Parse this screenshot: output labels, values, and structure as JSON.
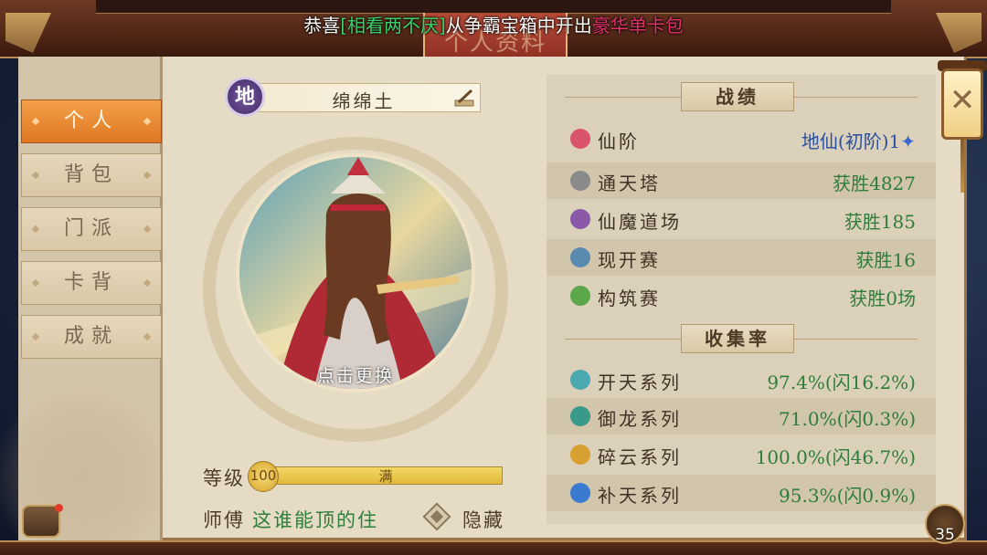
{
  "announcement": {
    "prefix": "恭喜",
    "player": "[相看两不厌]",
    "middle": "从争霸宝箱中开出",
    "item": "豪华单卡包"
  },
  "window_title": "个人资料",
  "sidebar": {
    "items": [
      {
        "label": "个人",
        "active": true
      },
      {
        "label": "背包",
        "active": false
      },
      {
        "label": "门派",
        "active": false
      },
      {
        "label": "卡背",
        "active": false
      },
      {
        "label": "成就",
        "active": false
      }
    ]
  },
  "profile": {
    "element_badge": "地",
    "name": "绵绵土",
    "change_label": "点击更换",
    "level_label": "等级",
    "level": "100",
    "level_fraction": 1.0,
    "level_full_label": "满",
    "master_label": "师傅",
    "master_name": "这谁能顶的住",
    "hide_label": "隐藏"
  },
  "record": {
    "title": "战绩",
    "rows": [
      {
        "label": "仙阶",
        "value": "地仙(初阶)1",
        "icon": "star-icon",
        "icon_color": "#d9546a"
      },
      {
        "label": "通天塔",
        "value": "获胜4827",
        "icon": "tower-icon",
        "icon_color": "#8a8a8a"
      },
      {
        "label": "仙魔道场",
        "value": "获胜185",
        "icon": "swords-icon",
        "icon_color": "#8a5aa8"
      },
      {
        "label": "现开赛",
        "value": "获胜16",
        "icon": "face-icon",
        "icon_color": "#5a8ab0"
      },
      {
        "label": "构筑赛",
        "value": "获胜0场",
        "icon": "leaf-icon",
        "icon_color": "#5aa84a"
      }
    ]
  },
  "collection": {
    "title": "收集率",
    "rows": [
      {
        "label": "开天系列",
        "value": "97.4%(闪16.2%)",
        "icon": "feather-icon",
        "icon_color": "#4aa8b0"
      },
      {
        "label": "御龙系列",
        "value": "71.0%(闪0.3%)",
        "icon": "dragon-icon",
        "icon_color": "#3a9a8a"
      },
      {
        "label": "碎云系列",
        "value": "100.0%(闪46.7%)",
        "icon": "cloud-swirl-icon",
        "icon_color": "#d8a030"
      },
      {
        "label": "补天系列",
        "value": "95.3%(闪0.9%)",
        "icon": "cloud-icon",
        "icon_color": "#3a7ad0"
      }
    ]
  },
  "corner_count": "35",
  "colors": {
    "accent_orange": "#e8842a",
    "value_green": "#2f7d3b",
    "panel_bg": "#e6dcc6"
  }
}
